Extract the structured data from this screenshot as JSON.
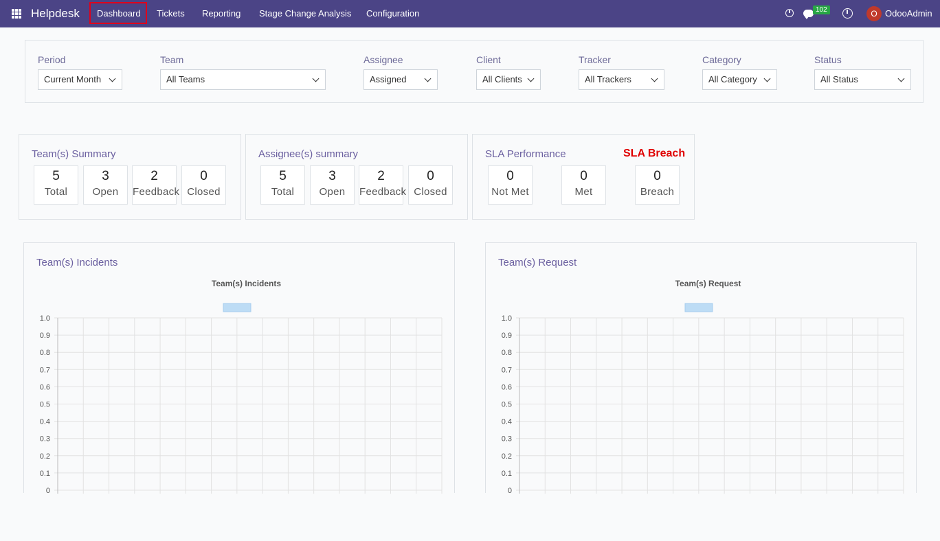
{
  "nav": {
    "app_title": "Helpdesk",
    "items": [
      "Dashboard",
      "Tickets",
      "Reporting",
      "Stage Change Analysis",
      "Configuration"
    ],
    "message_count": "102",
    "user_initial": "O",
    "user_name": "OdooAdmin"
  },
  "filters": [
    {
      "label": "Period",
      "value": "Current Month"
    },
    {
      "label": "Team",
      "value": "All Teams"
    },
    {
      "label": "Assignee",
      "value": "Assigned"
    },
    {
      "label": "Client",
      "value": "All Clients"
    },
    {
      "label": "Tracker",
      "value": "All Trackers"
    },
    {
      "label": "Category",
      "value": "All Category"
    },
    {
      "label": "Status",
      "value": "All Status"
    }
  ],
  "team_summary": {
    "title": "Team(s) Summary",
    "stats": [
      {
        "value": "5",
        "label": "Total"
      },
      {
        "value": "3",
        "label": "Open"
      },
      {
        "value": "2",
        "label": "Feedback"
      },
      {
        "value": "0",
        "label": "Closed"
      }
    ]
  },
  "assignee_summary": {
    "title": "Assignee(s) summary",
    "stats": [
      {
        "value": "5",
        "label": "Total"
      },
      {
        "value": "3",
        "label": "Open"
      },
      {
        "value": "2",
        "label": "Feedback"
      },
      {
        "value": "0",
        "label": "Closed"
      }
    ]
  },
  "sla": {
    "title": "SLA Performance",
    "breach_title": "SLA Breach",
    "stats": [
      {
        "value": "0",
        "label": "Not Met"
      },
      {
        "value": "0",
        "label": "Met"
      },
      {
        "value": "0",
        "label": "Breach"
      }
    ]
  },
  "chart_data": [
    {
      "type": "bar",
      "panel_title": "Team(s) Incidents",
      "title": "Team(s) Incidents",
      "categories": [],
      "series": [
        {
          "values": []
        }
      ],
      "ylim": [
        0,
        1.0
      ],
      "yticks": [
        "1.0",
        "0.9",
        "0.8",
        "0.7",
        "0.6",
        "0.5",
        "0.4",
        "0.3",
        "0.2",
        "0.1",
        "0"
      ],
      "grid": true,
      "legend_color": "#bddcf5"
    },
    {
      "type": "bar",
      "panel_title": "Team(s) Request",
      "title": "Team(s) Request",
      "categories": [],
      "series": [
        {
          "values": []
        }
      ],
      "ylim": [
        0,
        1.0
      ],
      "yticks": [
        "1.0",
        "0.9",
        "0.8",
        "0.7",
        "0.6",
        "0.5",
        "0.4",
        "0.3",
        "0.2",
        "0.1",
        "0"
      ],
      "grid": true,
      "legend_color": "#bddcf5"
    }
  ]
}
